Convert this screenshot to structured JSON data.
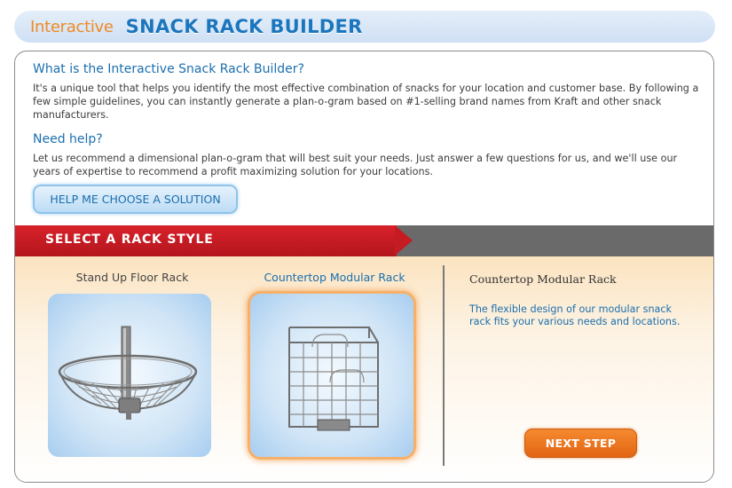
{
  "header": {
    "prefix": "Interactive",
    "title": "SNACK RACK BUILDER"
  },
  "intro": {
    "heading": "What is the Interactive Snack Rack Builder?",
    "body": "It's a unique tool that helps you identify the most effective combination of snacks for your location and customer base. By following a few simple guidelines, you can instantly generate a plan-o-gram based on #1-selling brand names from Kraft and other snack manufacturers."
  },
  "help": {
    "heading": "Need help?",
    "body": "Let us recommend a dimensional plan-o-gram that will best suit your needs. Just answer a few questions for us, and we'll use our years of expertise to recommend a profit maximizing solution for your locations.",
    "button_label": "HELP ME CHOOSE A SOLUTION"
  },
  "rack_section": {
    "label": "SELECT A RACK STYLE",
    "options": [
      {
        "title": "Stand Up Floor Rack",
        "icon": "floor-rack-image",
        "selected": false
      },
      {
        "title": "Countertop Modular Rack",
        "icon": "modular-rack-image",
        "selected": true
      }
    ],
    "detail": {
      "name": "Countertop Modular Rack",
      "description": "The flexible design of our modular snack rack fits your various needs and locations."
    },
    "next_label": "NEXT STEP"
  },
  "colors": {
    "accent_blue": "#1b6fae",
    "brand_orange": "#f08a24",
    "band_red": "#c51b22",
    "band_gray": "#6a6a6a",
    "next_orange": "#e26514"
  }
}
